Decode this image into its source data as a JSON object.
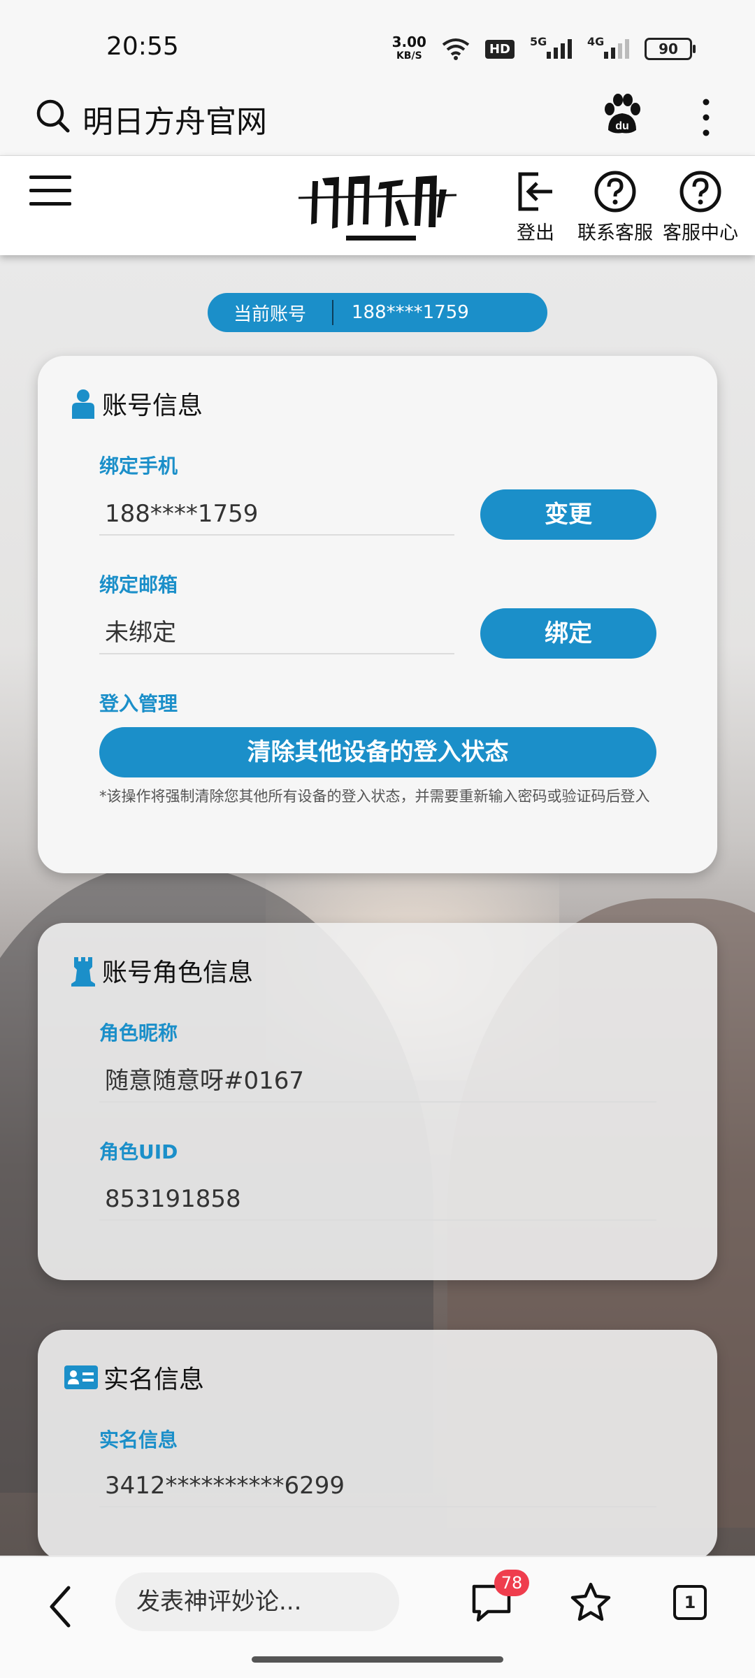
{
  "status_bar": {
    "time": "20:55",
    "net_speed_value": "3.00",
    "net_speed_unit": "KB/S",
    "hd_label": "HD",
    "signal_5g": "5G",
    "signal_4g": "4G",
    "battery": "90"
  },
  "browser": {
    "title": "明日方舟官网"
  },
  "header": {
    "logout_label": "登出",
    "contact_label": "联系客服",
    "service_center_label": "客服中心"
  },
  "account_pill": {
    "label": "当前账号",
    "value": "188****1759"
  },
  "account_info": {
    "title": "账号信息",
    "phone_label": "绑定手机",
    "phone_value": "188****1759",
    "phone_button": "变更",
    "email_label": "绑定邮箱",
    "email_value": "未绑定",
    "email_button": "绑定",
    "login_label": "登入管理",
    "clear_button": "清除其他设备的登入状态",
    "note": "*该操作将强制清除您其他所有设备的登入状态，并需要重新输入密码或验证码后登入"
  },
  "role_info": {
    "title": "账号角色信息",
    "nickname_label": "角色昵称",
    "nickname_value": "随意随意呀#0167",
    "uid_label": "角色UID",
    "uid_value": "853191858"
  },
  "realname": {
    "title": "实名信息",
    "label": "实名信息",
    "value": "3412**********6299"
  },
  "bottom_bar": {
    "comment_placeholder": "发表神评妙论...",
    "comment_badge": "78",
    "tab_count": "1"
  },
  "colors": {
    "accent": "#1b8fc9",
    "badge": "#ef3d4d"
  }
}
